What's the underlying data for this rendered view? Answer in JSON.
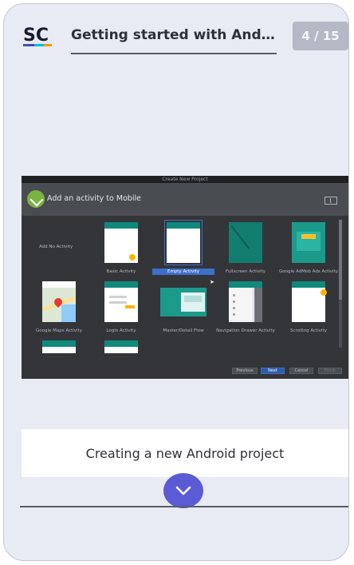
{
  "header": {
    "logo_text": "SC",
    "title": "Getting started with Androi...",
    "page_counter": "4 / 15"
  },
  "dialog": {
    "window_title": "Create New Project",
    "heading": "Add an activity to Mobile",
    "templates": [
      {
        "label": "Add No Activity"
      },
      {
        "label": "Basic Activity"
      },
      {
        "label": "Empty Activity",
        "selected": true
      },
      {
        "label": "Fullscreen Activity"
      },
      {
        "label": "Google AdMob Ads Activity"
      },
      {
        "label": "Google Maps Activity"
      },
      {
        "label": "Login Activity"
      },
      {
        "label": "Master/Detail Flow"
      },
      {
        "label": "Navigation Drawer Activity"
      },
      {
        "label": "Scrolling Activity"
      }
    ],
    "buttons": {
      "previous": "Previous",
      "next": "Next",
      "cancel": "Cancel",
      "finish": "Finish"
    }
  },
  "caption": "Creating a new Android project",
  "colors": {
    "accent": "#5b5bd6",
    "card_bg": "#e8eaf4",
    "teal": "#10897c"
  }
}
